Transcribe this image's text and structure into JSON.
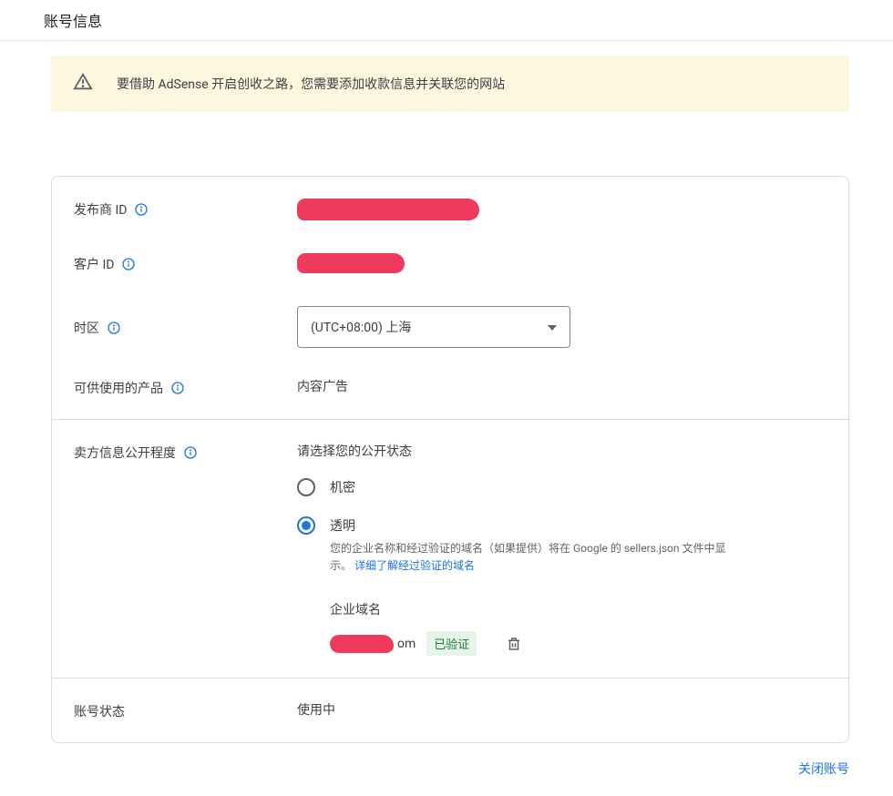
{
  "header": {
    "title": "账号信息"
  },
  "alert": {
    "message": "要借助 AdSense 开启创收之路，您需要添加收款信息并关联您的网站"
  },
  "fields": {
    "publisher_id_label": "发布商 ID",
    "customer_id_label": "客户 ID",
    "timezone_label": "时区",
    "timezone_value": "(UTC+08:00) 上海",
    "products_label": "可供使用的产品",
    "products_value": "内容广告",
    "visibility_label": "卖方信息公开程度",
    "status_label": "账号状态",
    "status_value": "使用中"
  },
  "visibility": {
    "prompt": "请选择您的公开状态",
    "opt_private": "机密",
    "opt_transparent": "透明",
    "transparent_desc": "您的企业名称和经过验证的域名（如果提供）将在 Google 的 sellers.json 文件中显示。",
    "learn_more": "详细了解经过验证的域名",
    "domain_label": "企业域名",
    "domain_suffix": "om",
    "verified_badge": "已验证"
  },
  "footer": {
    "close_account": "关闭账号"
  }
}
